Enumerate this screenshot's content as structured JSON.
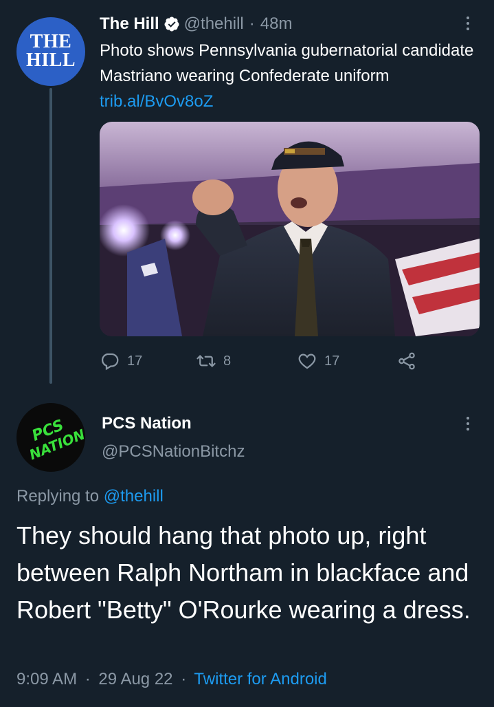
{
  "tweet1": {
    "avatar_text": [
      "THE",
      "HILL"
    ],
    "name": "The Hill",
    "handle": "@thehill",
    "separator": "·",
    "time": "48m",
    "text": "Photo shows Pennsylvania gubernatorial candidate Mastriano wearing Confederate uniform ",
    "link": "trib.al/BvOv8oZ",
    "reply_count": "17",
    "retweet_count": "8",
    "like_count": "17",
    "icons": {
      "verified": "verified-badge-icon",
      "more": "more-options-icon",
      "reply": "reply-icon",
      "retweet": "retweet-icon",
      "like": "heart-icon",
      "share": "share-icon"
    }
  },
  "tweet2": {
    "avatar_text": [
      "PCS",
      "NATION"
    ],
    "name": "PCS Nation",
    "handle": "@PCSNationBitchz",
    "replying_label": "Replying to ",
    "replying_handle": "@thehill",
    "text": "They should hang that photo up, right between Ralph Northam in blackface and Robert \"Betty\" O'Rourke wearing a dress.",
    "time": "9:09 AM",
    "date": "29 Aug 22",
    "source": "Twitter for Android",
    "separator": "·"
  },
  "colors": {
    "background": "#15202b",
    "link": "#1d9bf0",
    "muted": "#8b98a5",
    "hill_avatar": "#2c60c6",
    "pcs_green": "#39e03b"
  }
}
